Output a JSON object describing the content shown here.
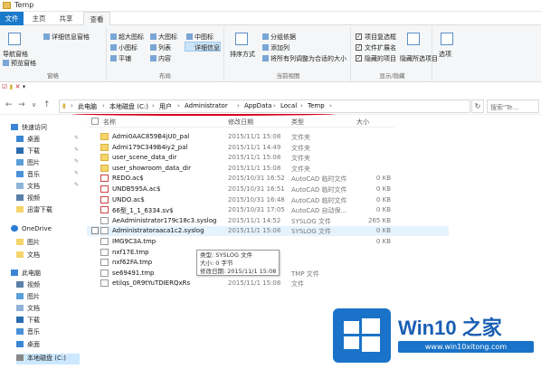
{
  "window": {
    "title": "Temp"
  },
  "tabs": [
    "文件",
    "主页",
    "共享",
    "查看"
  ],
  "ribbon": {
    "pane": {
      "nav_pane": "导航窗格",
      "preview_pane": "预览窗格",
      "details_pane": "详细信息窗格",
      "group_label": "窗格"
    },
    "layout": {
      "items": [
        "超大图标",
        "大图标",
        "中图标",
        "小图标",
        "列表",
        "详细信息",
        "平铺",
        "内容"
      ],
      "selected": "详细信息",
      "group_label": "布局"
    },
    "view": {
      "sort": "排序方式",
      "group_by": "分组依据",
      "add_column": "添加列",
      "fit_columns": "将所有列调整为合适的大小",
      "group_label": "当前视图"
    },
    "showhide": {
      "item_checkboxes": "项目复选框",
      "file_extensions": "文件扩展名",
      "hidden_items": "隐藏的项目",
      "hide_selected": "隐藏所选项目",
      "group_label": "显示/隐藏"
    },
    "options": "选项"
  },
  "address": {
    "crumbs": [
      "此电脑",
      "本地磁盘 (C:)",
      "用户",
      "Administrator",
      "AppData",
      "Local",
      "Temp"
    ],
    "search_placeholder": "搜索\"Te..."
  },
  "sidebar": {
    "items": [
      {
        "label": "快速访问",
        "icon": "star-icon"
      },
      {
        "label": "桌面",
        "icon": "desktop-icon",
        "pinned": true
      },
      {
        "label": "下载",
        "icon": "download-icon",
        "pinned": true
      },
      {
        "label": "图片",
        "icon": "pictures-icon",
        "pinned": true
      },
      {
        "label": "音乐",
        "icon": "music-icon",
        "pinned": true
      },
      {
        "label": "文档",
        "icon": "documents-icon",
        "pinned": true
      },
      {
        "label": "视频",
        "icon": "videos-icon"
      },
      {
        "label": "迅雷下载",
        "icon": "folder-icon"
      },
      {
        "label": "OneDrive",
        "icon": "cloud-icon"
      },
      {
        "label": "图片",
        "icon": "folder-icon"
      },
      {
        "label": "文档",
        "icon": "folder-icon"
      },
      {
        "label": "此电脑",
        "icon": "computer-icon"
      },
      {
        "label": "视频",
        "icon": "videos-icon"
      },
      {
        "label": "图片",
        "icon": "pictures-icon"
      },
      {
        "label": "文档",
        "icon": "documents-icon"
      },
      {
        "label": "下载",
        "icon": "download-icon"
      },
      {
        "label": "音乐",
        "icon": "music-icon"
      },
      {
        "label": "桌面",
        "icon": "desktop-icon"
      },
      {
        "label": "本地磁盘 (C:)",
        "icon": "drive-icon"
      }
    ]
  },
  "columns": {
    "name": "名称",
    "date": "修改日期",
    "type": "类型",
    "size": "大小"
  },
  "files": [
    {
      "name": "Admi0AAC859B4jU0_pal",
      "date": "2015/11/1 15:08",
      "type": "文件夹",
      "size": "",
      "kind": "folder"
    },
    {
      "name": "Admi179C349B4iy2_pal",
      "date": "2015/11/1 14:49",
      "type": "文件夹",
      "size": "",
      "kind": "folder"
    },
    {
      "name": "user_scene_data_dir",
      "date": "2015/11/1 15:08",
      "type": "文件夹",
      "size": "",
      "kind": "folder"
    },
    {
      "name": "user_showroom_data_dir",
      "date": "2015/11/1 15:08",
      "type": "文件夹",
      "size": "",
      "kind": "folder"
    },
    {
      "name": "REDO.ac$",
      "date": "2015/10/31 16:52",
      "type": "AutoCAD 临时文件",
      "size": "0 KB",
      "kind": "cad"
    },
    {
      "name": "UNDB595A.ac$",
      "date": "2015/10/31 16:51",
      "type": "AutoCAD 临时文件",
      "size": "0 KB",
      "kind": "cad"
    },
    {
      "name": "UNDO.ac$",
      "date": "2015/10/31 16:48",
      "type": "AutoCAD 临时文件",
      "size": "0 KB",
      "kind": "cad"
    },
    {
      "name": "66型_1_1_6334.sv$",
      "date": "2015/10/31 17:05",
      "type": "AutoCAD 自动保...",
      "size": "0 KB",
      "kind": "cad"
    },
    {
      "name": "AeAdministrator179c18c3.syslog",
      "date": "2015/11/1 14:52",
      "type": "SYSLOG 文件",
      "size": "265 KB",
      "kind": "file"
    },
    {
      "name": "Administratoraaca1c2.syslog",
      "date": "2015/11/1 15:08",
      "type": "SYSLOG 文件",
      "size": "0 KB",
      "kind": "file",
      "selected": true
    },
    {
      "name": "IMG9C3A.tmp",
      "date": "",
      "type": "",
      "size": "0 KB",
      "kind": "file"
    },
    {
      "name": "nxf17E.tmp",
      "date": "",
      "type": "",
      "size": "",
      "kind": "file"
    },
    {
      "name": "nxf62FA.tmp",
      "date": "",
      "type": "",
      "size": "",
      "kind": "file"
    },
    {
      "name": "se69491.tmp",
      "date": "2017/7/8 15:36",
      "type": "TMP 文件",
      "size": "",
      "kind": "file"
    },
    {
      "name": "etilqs_0R9tYuTDIERQxRs",
      "date": "2015/11/1 15:08",
      "type": "文件",
      "size": "",
      "kind": "file"
    }
  ],
  "tooltip": {
    "line1": "类型: SYSLOG 文件",
    "line2": "大小: 0 字节",
    "line3": "修改日期: 2015/11/1 15:08"
  },
  "watermark": {
    "brand": "Win10 之家",
    "url": "www.win10xitong.com"
  },
  "colors": {
    "accent": "#1979ca",
    "selection": "#e5f3ff",
    "annotation": "#d6001c"
  }
}
